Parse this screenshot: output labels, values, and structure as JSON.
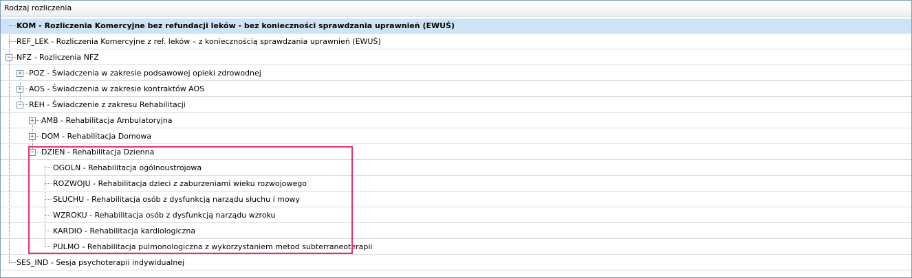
{
  "column_header": "Rodzaj rozliczenia",
  "rows": [
    {
      "text": "KOM - Rozliczenia Komercyjne bez refundacji leków - bez konieczności sprawdzania uprawnień (EWUŚ)",
      "selected": true
    },
    {
      "text": "REF_LEK - Rozliczenia Komercyjne z ref. leków – z koniecznością sprawdzania uprawnień (EWUŚ)"
    },
    {
      "text": "NFZ - Rozliczenia NFZ",
      "expander": "−"
    },
    {
      "text": "POZ - Świadczenia w zakresie podsawowej opieki zdrowodnej",
      "expander": "+"
    },
    {
      "text": "AOS - Świadczenia w zakresie kontraktów AOS",
      "expander": "+"
    },
    {
      "text": "REH - Świadczenie z zakresu Rehabilitacji",
      "expander": "−"
    },
    {
      "text": "AMB - Rehabilitacja Ambulatoryjna",
      "expander": "+"
    },
    {
      "text": "DOM - Rehabilitacja Domowa",
      "expander": "+"
    },
    {
      "text": "DZIEN - Rehabilitacja Dzienna",
      "expander": "−"
    },
    {
      "text": "OGOLN - Rehabilitacja ogólnoustrojowa"
    },
    {
      "text": "ROZWOJU - Rehabilitacja dzieci z zaburzeniami wieku rozwojowego"
    },
    {
      "text": "SŁUCHU - Rehabilitacja osób z dysfunkcją narządu słuchu i mowy"
    },
    {
      "text": "WZROKU - Rehabilitacja osób z dysfunkcją narządu wzroku"
    },
    {
      "text": "KARDIO - Rehabilitacja kardiologiczna"
    },
    {
      "text": "PULMO - Rehabilitacja pulmonologiczna z wykorzystaniem metod subterraneoterapii"
    },
    {
      "text": "SES_IND - Sesja psychoterapii indywidualnej"
    }
  ]
}
